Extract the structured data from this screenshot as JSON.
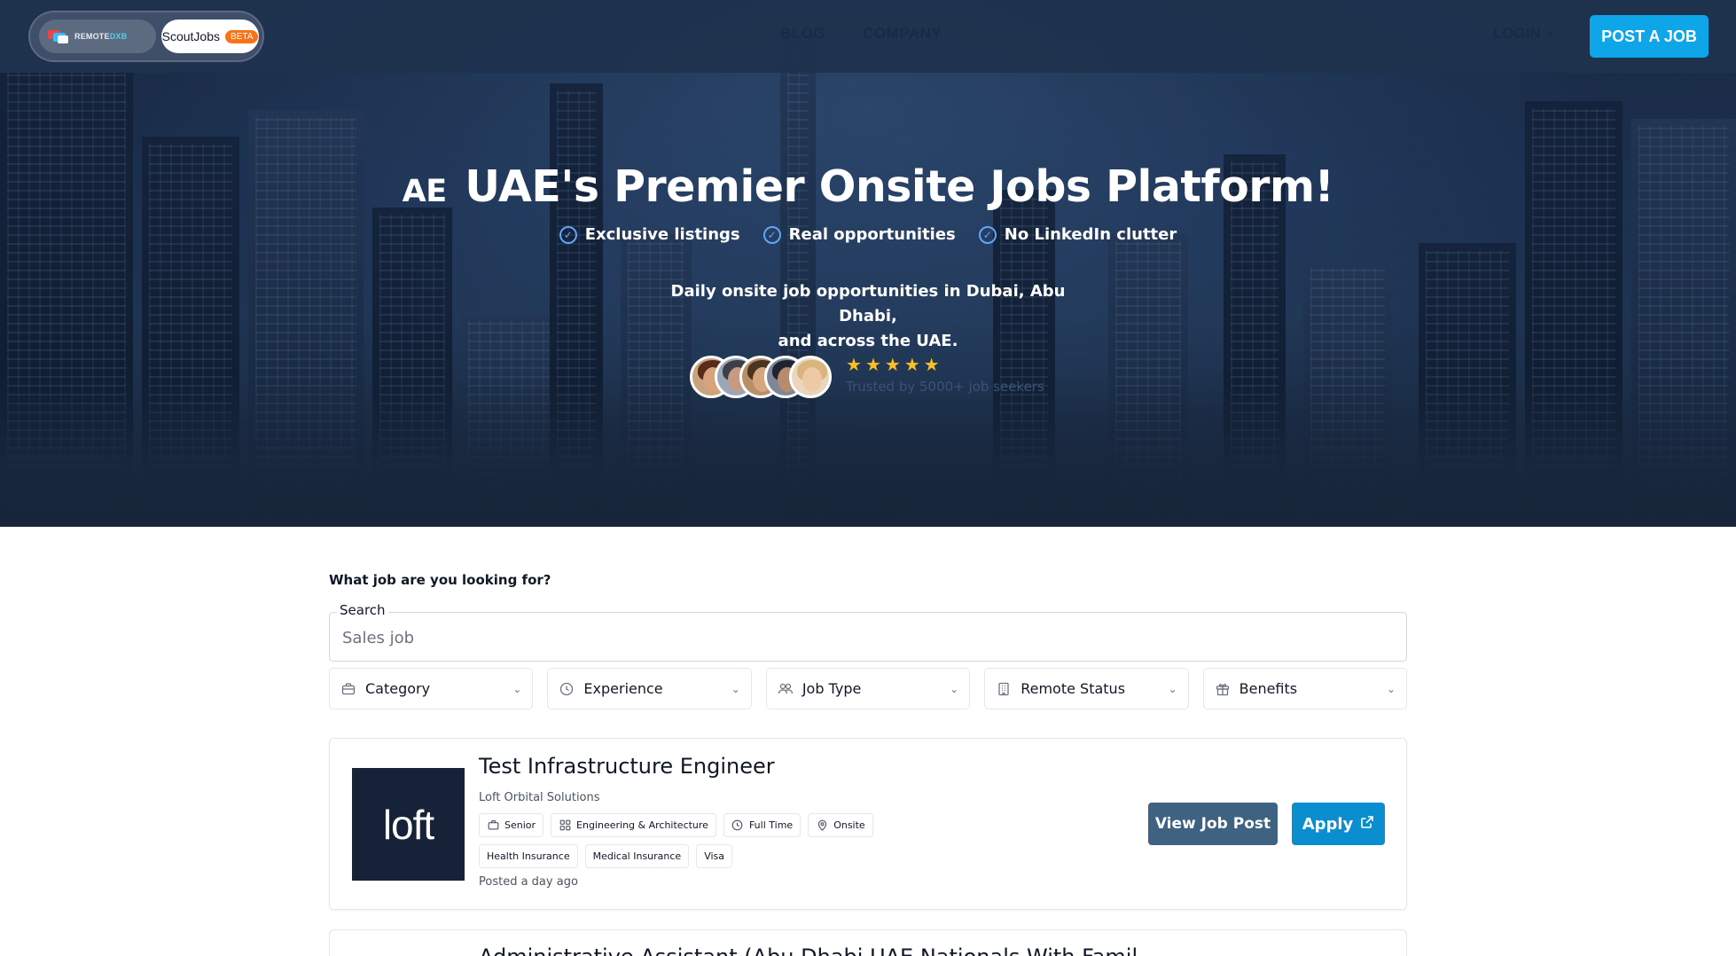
{
  "navbar": {
    "brand_remote": "REMOTE",
    "brand_remote_accent": "DXB",
    "brand_scout": "ScoutJobs",
    "beta_badge": "BETA",
    "links": [
      "BLOG",
      "COMPANY"
    ],
    "login": "LOGIN",
    "post_job": "POST A JOB"
  },
  "hero": {
    "flag": "AE",
    "title": "UAE's Premier Onsite Jobs Platform!",
    "features": [
      "Exclusive listings",
      "Real opportunities",
      "No LinkedIn clutter"
    ],
    "tagline_prefix": "Daily onsite job opportunities in ",
    "tagline_bold": "Dubai, Abu Dhabi,",
    "tagline_line2": "and across the UAE.",
    "rating_stars": 5,
    "trusted": "Trusted by 5000+ job seekers"
  },
  "search": {
    "question": "What job are you looking for?",
    "label": "Search",
    "placeholder": "Sales job"
  },
  "filters": [
    {
      "label": "Category",
      "icon": "briefcase-icon"
    },
    {
      "label": "Experience",
      "icon": "clock-icon"
    },
    {
      "label": "Job Type",
      "icon": "users-icon"
    },
    {
      "label": "Remote Status",
      "icon": "building-icon"
    },
    {
      "label": "Benefits",
      "icon": "gift-icon"
    }
  ],
  "jobs": [
    {
      "logo_text": "loft",
      "title": "Test Infrastructure Engineer",
      "company": "Loft Orbital Solutions",
      "tags": [
        {
          "label": "Senior",
          "icon": "briefcase-icon"
        },
        {
          "label": "Engineering & Architecture",
          "icon": "grid-icon"
        },
        {
          "label": "Full Time",
          "icon": "clock-icon"
        },
        {
          "label": "Onsite",
          "icon": "location-icon"
        }
      ],
      "benefits": [
        "Health Insurance",
        "Medical Insurance",
        "Visa"
      ],
      "posted": "Posted a day ago",
      "view_button": "View Job Post",
      "apply_button": "Apply"
    },
    {
      "title": "Administrative Assistant (Abu Dhabi UAE Nationals With Famil"
    }
  ]
}
